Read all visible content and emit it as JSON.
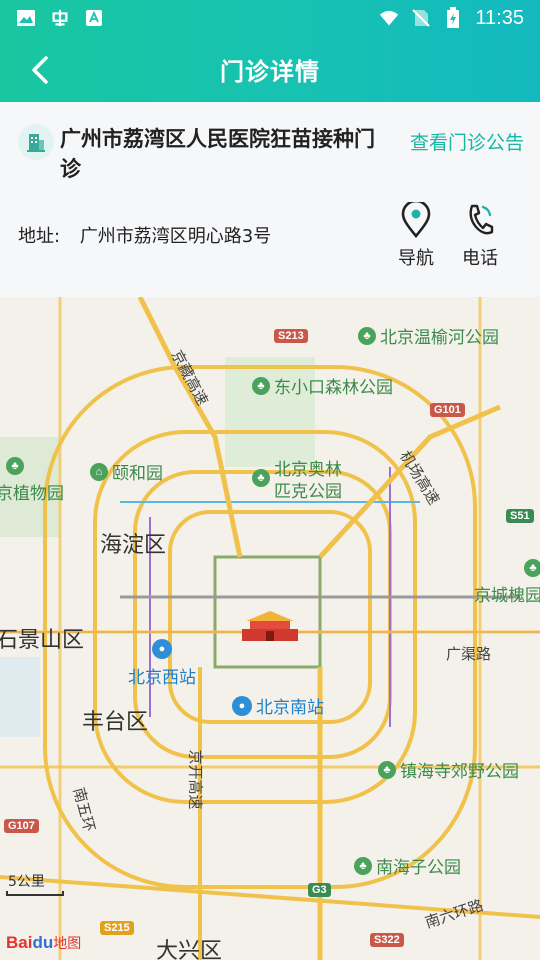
{
  "status_bar": {
    "time": "11:35"
  },
  "header": {
    "title": "门诊详情"
  },
  "clinic": {
    "name": "广州市荔湾区人民医院狂苗接种门诊",
    "notice_link": "查看门诊公告",
    "address_label": "地址:",
    "address_value": "广州市荔湾区明心路3号",
    "nav_label": "导航",
    "phone_label": "电话"
  },
  "map": {
    "districts": [
      "海淀区",
      "石景山区",
      "丰台区",
      "大兴区"
    ],
    "parks": [
      "北京温榆河公园",
      "东小口森林公园",
      "颐和园",
      "北京奥林匹克公园",
      "京植物园",
      "京城槐园",
      "镇海寺郊野公园",
      "南海子公园"
    ],
    "stations": [
      "北京西站",
      "北京南站"
    ],
    "roads": [
      "京藏高速",
      "机场高速",
      "京开高速",
      "南五环",
      "南六环路",
      "广渠路"
    ],
    "shields": [
      "S213",
      "G101",
      "S51",
      "G107",
      "G3",
      "S322",
      "S215"
    ],
    "scale": "5公里",
    "logo_text": "Bai",
    "logo_du": "du",
    "logo_map": "地图"
  },
  "colors": {
    "header_start": "#19c6a0",
    "header_end": "#13b9bf",
    "accent": "#18b7a5"
  }
}
